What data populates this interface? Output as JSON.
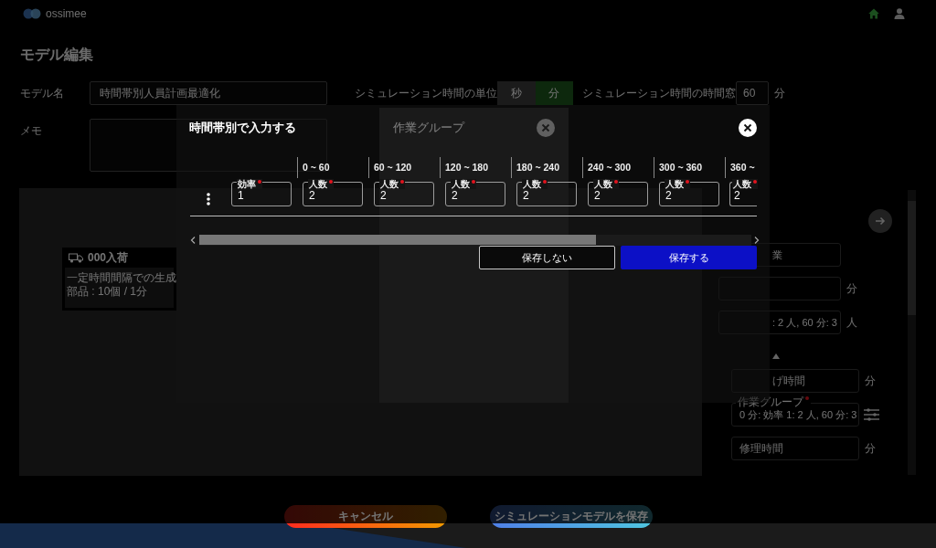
{
  "header": {
    "logo_text": "ossimee"
  },
  "page_title": "モデル編集",
  "form": {
    "model_name": {
      "label": "モデル名",
      "value": "時間帯別人員計画最適化"
    },
    "time_unit": {
      "label": "シミュレーション時間の単位",
      "options": [
        {
          "label": "秒",
          "selected": false
        },
        {
          "label": "分",
          "selected": true
        }
      ]
    },
    "time_window": {
      "label": "シミュレーション時間の時間窓",
      "value": "60",
      "unit": "分"
    },
    "memo": {
      "label": "メモ"
    }
  },
  "canvas": {
    "nodes": [
      {
        "title": "000入荷",
        "lines": [
          "一定時間間隔での生成",
          "部品 : 10個 / 1分"
        ]
      }
    ]
  },
  "properties": {
    "fields": [
      {
        "kind": "input",
        "value": "業"
      },
      {
        "kind": "input",
        "unit": "分"
      },
      {
        "kind": "input",
        "value": ": 2 人, 60 分: 3",
        "unit": "人"
      }
    ],
    "section": {
      "expanded": true,
      "fields": [
        {
          "kind": "input",
          "placeholder": "げ時間",
          "unit": "分"
        },
        {
          "kind": "editor",
          "label": "作業グループ",
          "required": true,
          "value": "0 分: 効率 1: 2 人, 60 分: 3"
        },
        {
          "kind": "input",
          "placeholder": "修理時間",
          "unit": "分"
        }
      ]
    }
  },
  "actions": [
    {
      "kind": "cancel",
      "label": "キャンセル"
    },
    {
      "kind": "save",
      "label": "シミュレーションモデルを保存"
    }
  ],
  "group_dialog": {
    "title": "作業グループ"
  },
  "time_band_dialog": {
    "title": "時間帯別で入力する",
    "columns": [
      {
        "field": {
          "label": "効率",
          "required": true,
          "value": "1"
        }
      },
      {
        "header": "0 ~ 60",
        "field": {
          "label": "人数",
          "required": true,
          "value": "2"
        }
      },
      {
        "header": "60 ~ 120",
        "field": {
          "label": "人数",
          "required": true,
          "value": "2"
        }
      },
      {
        "header": "120 ~ 180",
        "field": {
          "label": "人数",
          "required": true,
          "value": "2"
        }
      },
      {
        "header": "180 ~ 240",
        "field": {
          "label": "人数",
          "required": true,
          "value": "2"
        }
      },
      {
        "header": "240 ~ 300",
        "field": {
          "label": "人数",
          "required": true,
          "value": "2"
        }
      },
      {
        "header": "300 ~ 360",
        "field": {
          "label": "人数",
          "required": true,
          "value": "2"
        }
      },
      {
        "header": "360 ~",
        "field": {
          "label": "人数",
          "required": true,
          "value": "2"
        }
      }
    ],
    "buttons": [
      {
        "kind": "secondary",
        "label": "保存しない"
      },
      {
        "kind": "primary",
        "label": "保存する"
      }
    ]
  }
}
